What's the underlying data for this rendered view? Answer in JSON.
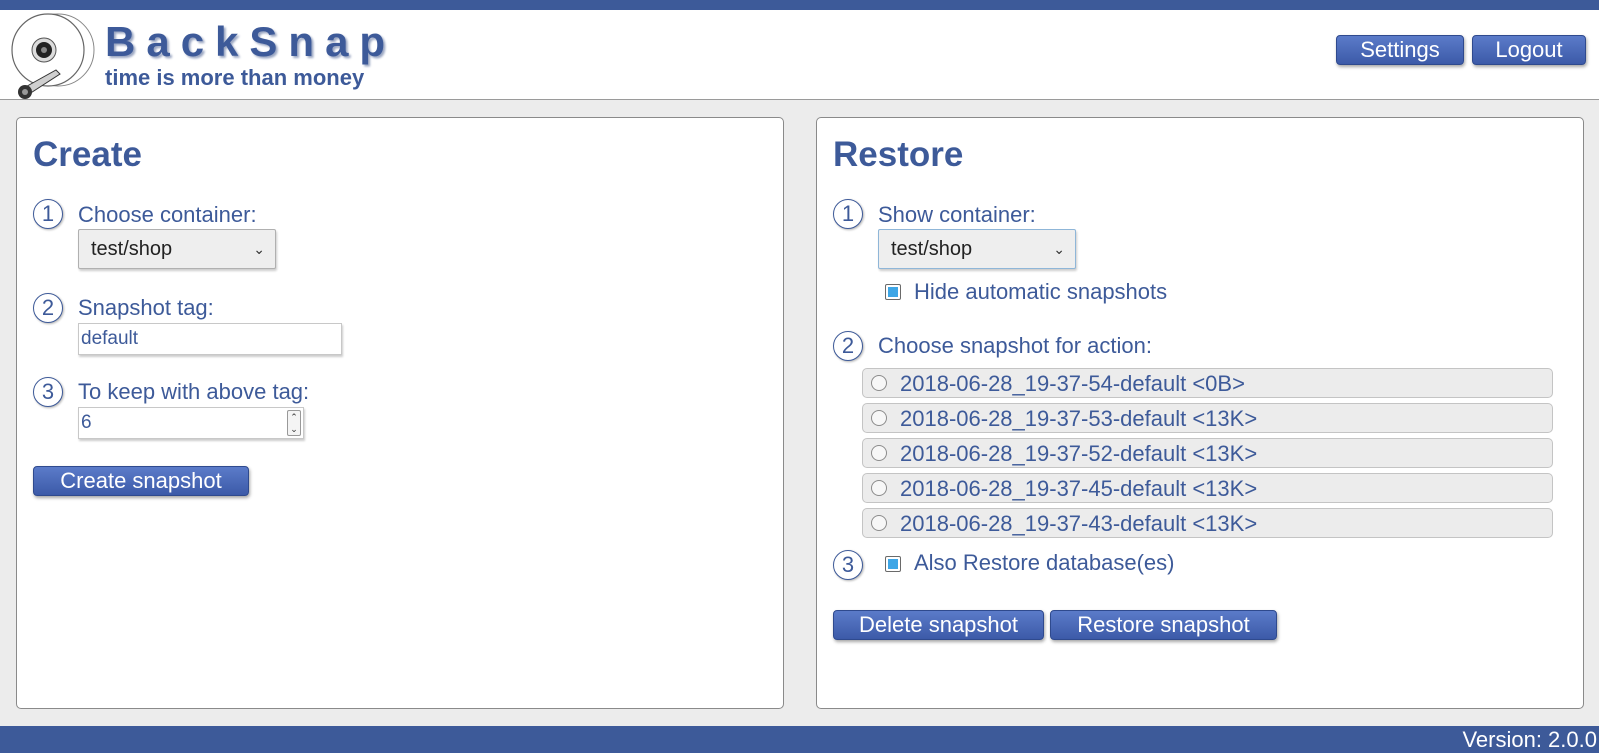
{
  "app": {
    "title": "BackSnap",
    "tagline": "time is more than money",
    "colors": {
      "primary": "#3d5a99",
      "check": "#3ea6e6",
      "background": "#ececec"
    }
  },
  "header": {
    "settings_label": "Settings",
    "logout_label": "Logout"
  },
  "create": {
    "title": "Create",
    "steps": [
      {
        "num": "1",
        "label": "Choose container:"
      },
      {
        "num": "2",
        "label": "Snapshot tag:"
      },
      {
        "num": "3",
        "label": "To keep with above tag:"
      }
    ],
    "container_value": "test/shop",
    "tag_value": "default",
    "keep_value": "6",
    "button_label": "Create snapshot"
  },
  "restore": {
    "title": "Restore",
    "steps": [
      {
        "num": "1",
        "label": "Show container:"
      },
      {
        "num": "2",
        "label": "Choose snapshot for action:"
      },
      {
        "num": "3"
      }
    ],
    "container_value": "test/shop",
    "hide_auto_label": "Hide automatic snapshots",
    "hide_auto_checked": true,
    "snapshots": [
      {
        "label": "2018-06-28_19-37-54-default <0B>",
        "selected": false
      },
      {
        "label": "2018-06-28_19-37-53-default <13K>",
        "selected": false
      },
      {
        "label": "2018-06-28_19-37-52-default <13K>",
        "selected": false
      },
      {
        "label": "2018-06-28_19-37-45-default <13K>",
        "selected": false
      },
      {
        "label": "2018-06-28_19-37-43-default <13K>",
        "selected": false
      }
    ],
    "restore_db_label": "Also Restore database(es)",
    "restore_db_checked": true,
    "delete_label": "Delete snapshot",
    "restore_label": "Restore snapshot"
  },
  "footer": {
    "version": "Version: 2.0.0"
  }
}
